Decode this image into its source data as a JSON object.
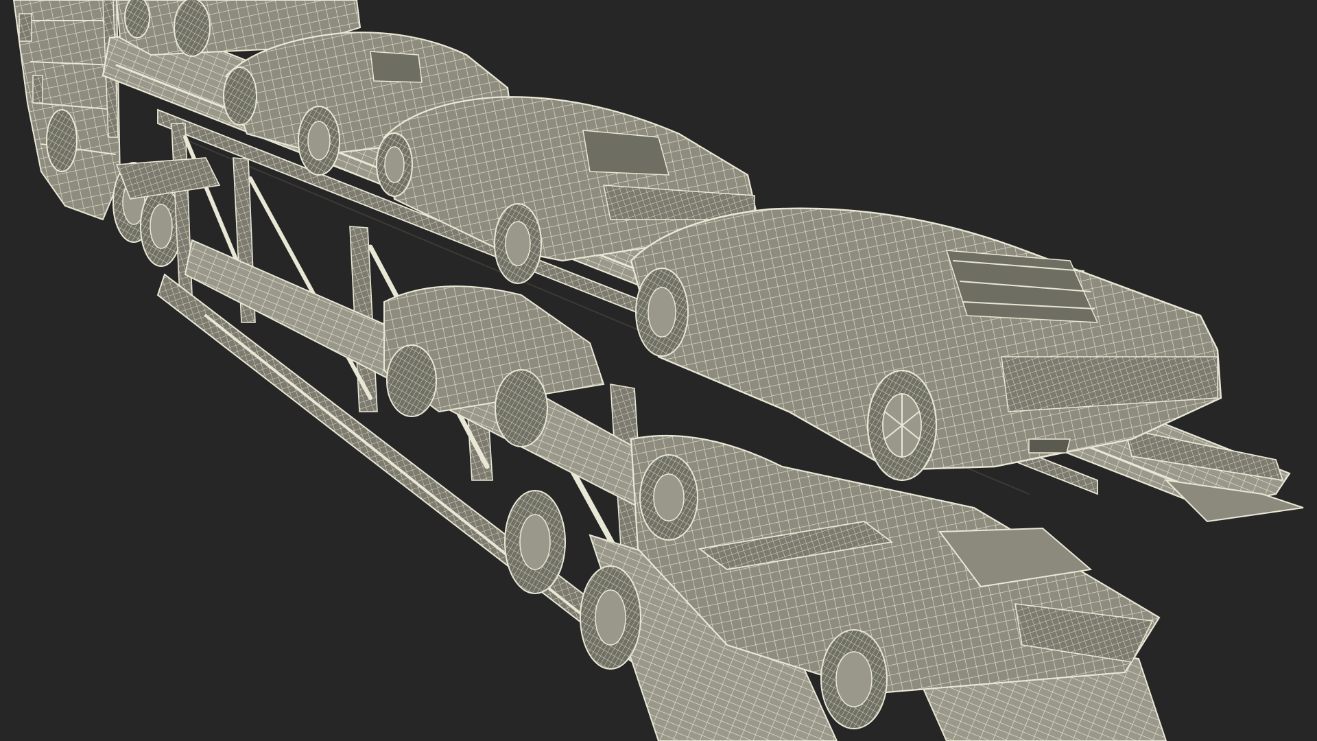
{
  "scene": {
    "background": "#262626",
    "model_fill": "#8c8a7c",
    "model_shadow": "#5b5a51",
    "wire_color": "#e9e8d6",
    "wire_dark": "#3b3a34"
  }
}
